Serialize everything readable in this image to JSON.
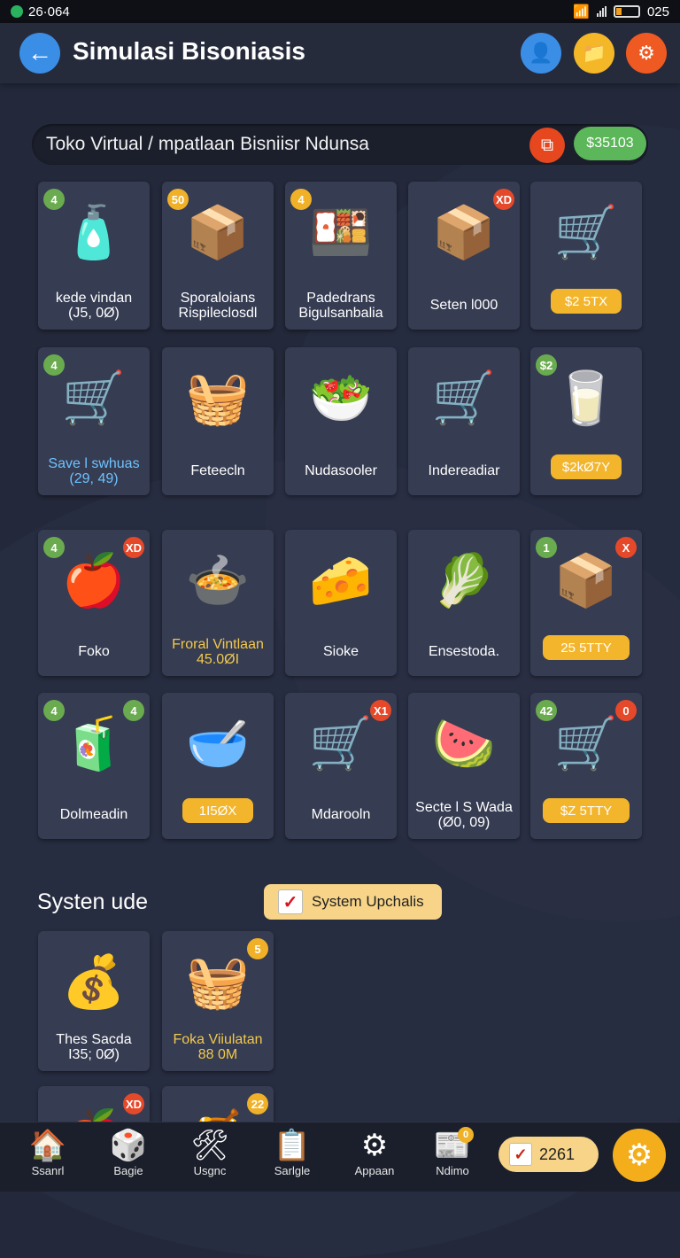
{
  "status_bar": {
    "left": "26·064",
    "right": "025",
    "battery_level": 0.25
  },
  "header": {
    "title": "Simulasi Bisoniasis",
    "back_icon": "arrow-left-icon",
    "buttons": [
      {
        "name": "user-icon",
        "color": "#3b8ee6"
      },
      {
        "name": "folder-icon",
        "color": "#f4b728"
      },
      {
        "name": "gear-icon",
        "color": "#ef5a22"
      }
    ]
  },
  "search": {
    "text": "Toko Virtual / mpatlaan Bisniisr Ndunsa",
    "balance": "$35103"
  },
  "grid": [
    {
      "icon": "paint-can-icon",
      "emoji": "🧴",
      "badge_left": "4",
      "badge_left_color": "green",
      "label": "kede vindan",
      "sublabel": "(J5, 0Ø)",
      "label_color": "white"
    },
    {
      "icon": "box-icon",
      "emoji": "📦",
      "badge_left": "50",
      "badge_left_color": "yellow",
      "label": "Sporaloians",
      "sublabel": "Rispileclosdl",
      "label_color": "white"
    },
    {
      "icon": "package-icon",
      "emoji": "🍱",
      "badge_left": "4",
      "badge_left_color": "yellow",
      "label": "Padedrans",
      "sublabel": "Bigulsanbalia",
      "label_color": "white"
    },
    {
      "icon": "cardboard-box-icon",
      "emoji": "📦",
      "badge_right": "XD",
      "badge_right_color": "red",
      "label": "Seten l000",
      "label_color": "white"
    },
    {
      "icon": "market-cart-icon",
      "emoji": "🛒",
      "price": "$2 5TX"
    },
    {
      "icon": "cart-icon",
      "emoji": "🛒",
      "badge_left": "4",
      "badge_left_color": "green",
      "label": "Save l swhuas",
      "sublabel": "(29, 49)",
      "label_color": "blue"
    },
    {
      "icon": "crate-icon",
      "emoji": "🧺",
      "label": "Feteecln",
      "label_color": "white"
    },
    {
      "icon": "vegetable-crate-icon",
      "emoji": "🥗",
      "label": "Nudasooler",
      "label_color": "white"
    },
    {
      "icon": "cart-icon",
      "emoji": "🛒",
      "label": "Indereadiar",
      "label_color": "white"
    },
    {
      "icon": "milk-box-icon",
      "emoji": "🥛",
      "badge_left": "$2",
      "badge_left_color": "green",
      "price": "$2kØ7Y"
    },
    {
      "icon": "produce-box-icon",
      "emoji": "🍎",
      "badge_left": "4",
      "badge_left_color": "green",
      "badge_right": "XD",
      "badge_right_color": "red",
      "label": "Foko",
      "label_color": "white"
    },
    {
      "icon": "food-tray-icon",
      "emoji": "🍲",
      "label": "Froral Vintlaan",
      "sublabel": "45.0ØI",
      "label_color": "yellow"
    },
    {
      "icon": "cheese-box-icon",
      "emoji": "🧀",
      "label": "Sioke",
      "label_color": "white"
    },
    {
      "icon": "blue-cart-icon",
      "emoji": "🥬",
      "label": "Ensestoda.",
      "label_color": "white"
    },
    {
      "icon": "supply-crate-icon",
      "emoji": "📦",
      "badge_left": "1",
      "badge_left_color": "green",
      "badge_right": "X",
      "badge_right_color": "red",
      "price": "25 5TTY"
    },
    {
      "icon": "juice-box-icon",
      "emoji": "🧃",
      "badge_left": "4",
      "badge_left_color": "green",
      "badge_right": "4",
      "badge_right_color": "green",
      "label": "Dolmeadin",
      "label_color": "white"
    },
    {
      "icon": "cereal-box-icon",
      "emoji": "🥣",
      "price": "1I5ØX"
    },
    {
      "icon": "cart-icon",
      "emoji": "🛒",
      "badge_right": "X1",
      "badge_right_color": "red",
      "label": "Mdarooln",
      "label_color": "white"
    },
    {
      "icon": "fruit-cart-icon",
      "emoji": "🍉",
      "label": "Secte l S Wada",
      "sublabel": "(Ø0, 09)",
      "label_color": "white"
    },
    {
      "icon": "veggie-cart-icon",
      "emoji": "🛒",
      "badge_left": "42",
      "badge_left_color": "green",
      "badge_right": "0",
      "badge_right_color": "red",
      "price": "$Z 5TTY"
    }
  ],
  "section": {
    "title": "Systen ude",
    "button_label": "System Upchalis"
  },
  "section_cards": [
    {
      "icon": "coin-box-icon",
      "emoji": "💰",
      "label": "Thes Sacda",
      "sublabel": "I35; 0Ø)",
      "label_color": "white"
    },
    {
      "icon": "grocery-basket-icon",
      "emoji": "🧺",
      "badge_right": "5",
      "badge_right_color": "yellow",
      "label": "Foka Viiulatan",
      "sublabel": "88 0M",
      "label_color": "yellow"
    },
    {
      "icon": "apple-icon",
      "emoji": "🍎",
      "badge_right": "XD",
      "badge_right_color": "red"
    },
    {
      "icon": "pot-icon",
      "emoji": "🍯",
      "badge_right": "22",
      "badge_right_color": "yellow"
    }
  ],
  "nav": {
    "items": [
      {
        "label": "Ssanrl",
        "icon": "store-icon",
        "emoji": "🏠"
      },
      {
        "label": "Bagie",
        "icon": "dice-icon",
        "emoji": "🎲"
      },
      {
        "label": "Usgnc",
        "icon": "tools-icon",
        "emoji": "🛠"
      },
      {
        "label": "Sarlgle",
        "icon": "document-icon",
        "emoji": "📋"
      },
      {
        "label": "Appaan",
        "icon": "gear-icon",
        "emoji": "⚙"
      },
      {
        "label": "Ndimo",
        "icon": "list-icon",
        "emoji": "📰",
        "badge": "0"
      }
    ],
    "counter": "2261"
  }
}
